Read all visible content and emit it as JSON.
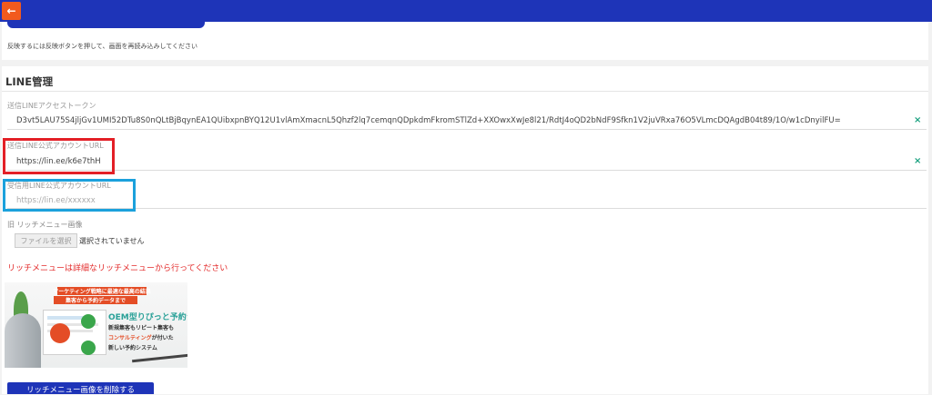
{
  "colors": {
    "topbar": "#1e34b8",
    "back_button": "#f25a1d",
    "highlight_red": "#e31f26",
    "highlight_blue": "#1ba1dc",
    "warning_text": "#e32b2b",
    "clear_icon": "#18a07e"
  },
  "header": {
    "back_icon": "arrow-left-icon",
    "back_glyph": "←"
  },
  "reflect": {
    "note": "反映するには反映ボタンを押して、画面を再読み込みしてください"
  },
  "line_section": {
    "title": "LINE管理",
    "fields": [
      {
        "label": "送信LINEアクセストークン",
        "value": "D3vt5LAU75S4jljGv1UMI52DTu8S0nQLtBjBqynEA1QUibxpnBYQ12U1vlAmXmacnL5Qhzf2lq7cemqnQDpkdmFkromSTlZd+XXOwxXwJe8l21/RdtJ4oQD2bNdF9Sfkn1V2juVRxa76O5VLmcDQAgdB04t89/1O/w1cDnyilFU=",
        "placeholder": "",
        "clear_icon": "x-icon",
        "clear_glyph": "×"
      },
      {
        "label": "送信LINE公式アカウントURL",
        "value": "https://lin.ee/k6e7thH",
        "placeholder": "",
        "clear_icon": "x-icon",
        "clear_glyph": "×"
      },
      {
        "label": "受信用LINE公式アカウントURL",
        "value": "",
        "placeholder": "https://lin.ee/xxxxxx"
      }
    ]
  },
  "rich_menu": {
    "label": "旧 リッチメニュー画像",
    "file_button": "ファイルを選択",
    "file_status": "選択されていません",
    "warning": "リッチメニューは詳細なリッチメニューから行ってください",
    "banner": {
      "ribbon1": "マーケティング戦略に最適な最高の結果",
      "ribbon2": "集客から予約データまで",
      "headline": "OEM型りぴっと予約システム",
      "line1": "新規集客もリピート集客も",
      "line2_em": "コンサルティング",
      "line2_rest": "が付いた",
      "line3": "新しい予約システム"
    },
    "delete_button": "リッチメニュー画像を削除する"
  }
}
